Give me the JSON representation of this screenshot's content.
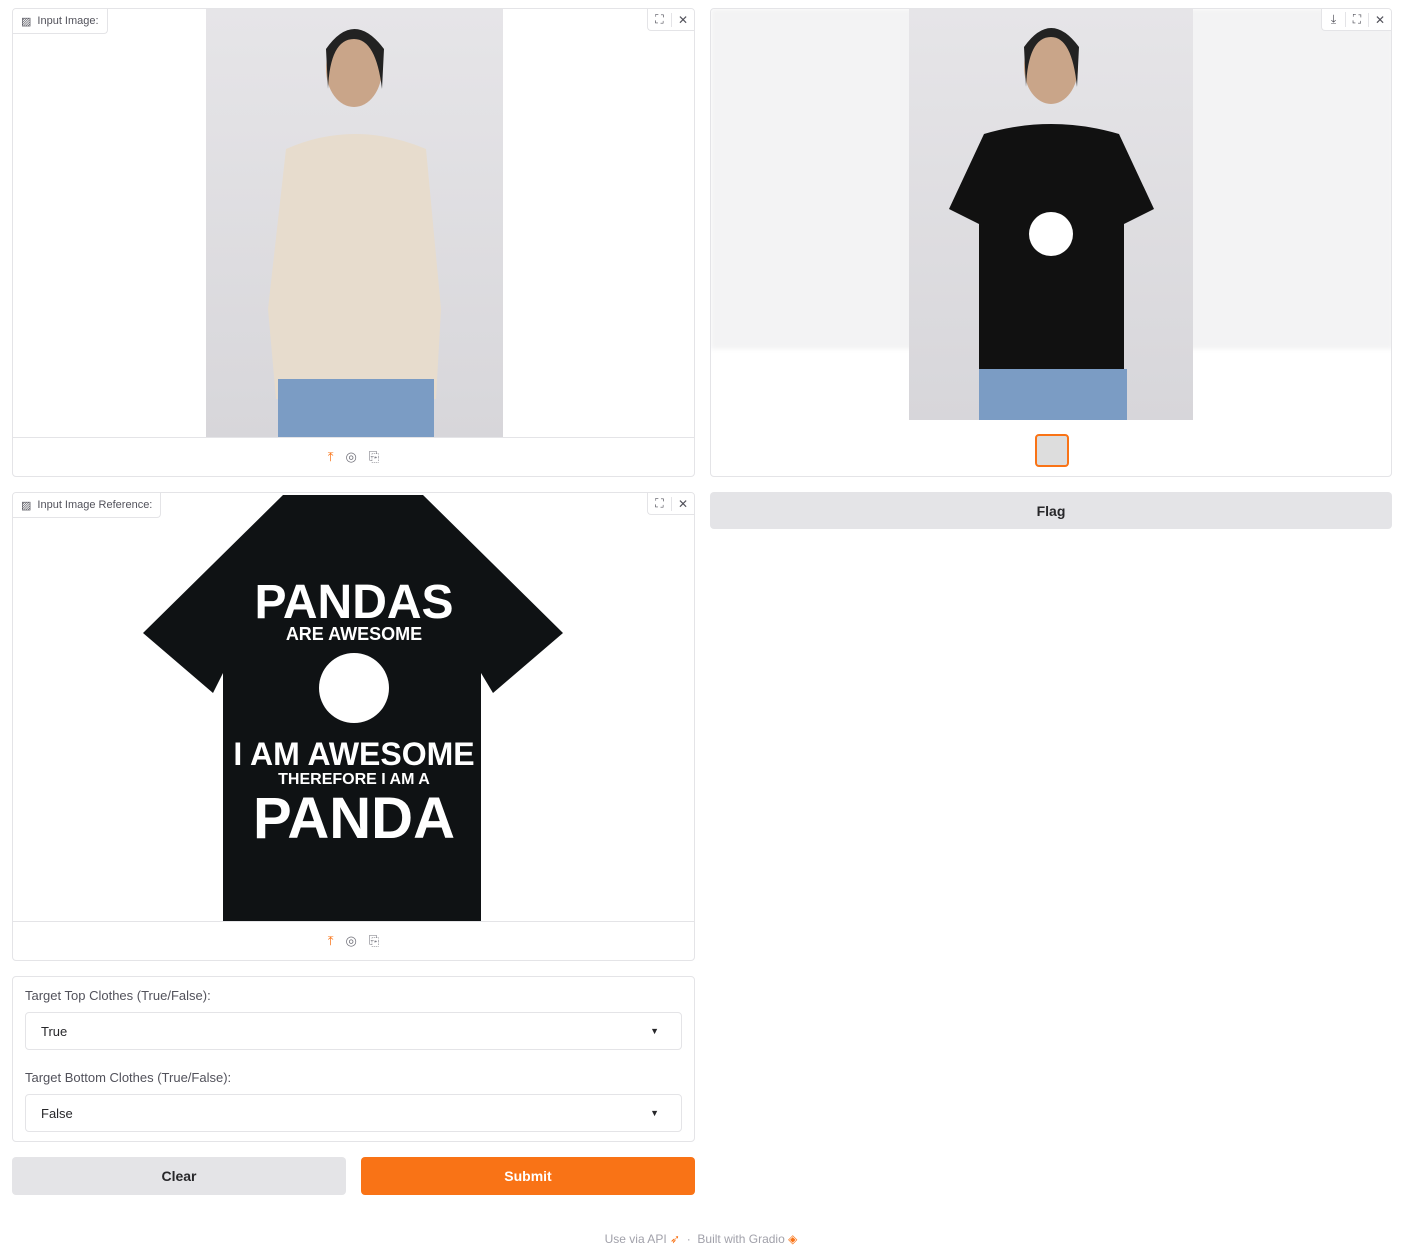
{
  "input_image": {
    "label": "Input Image:"
  },
  "reference_image": {
    "label": "Input Image Reference:"
  },
  "shirt_print": [
    "PANDAS",
    "ARE AWESOME",
    "I AM AWESOME",
    "THEREFORE I AM A",
    "PANDA"
  ],
  "dropdowns": [
    {
      "label": "Target Top Clothes (True/False):",
      "value": "True"
    },
    {
      "label": "Target Bottom Clothes (True/False):",
      "value": "False"
    }
  ],
  "buttons": {
    "clear": "Clear",
    "submit": "Submit",
    "flag": "Flag"
  },
  "footer": {
    "api": "Use via API",
    "sep": "·",
    "built": "Built with Gradio"
  },
  "colors": {
    "accent": "#f97316",
    "secondary": "#e4e4e7"
  }
}
